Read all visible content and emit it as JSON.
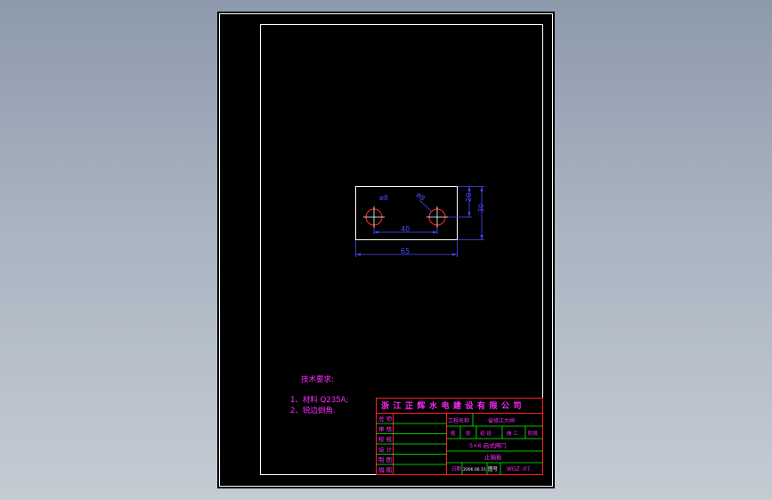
{
  "drawing": {
    "dimensions": {
      "hole_diameter": "ø8",
      "hole_diameter_2": "ø8",
      "height_inner": "20",
      "height_outer": "30",
      "hole_spacing": "40",
      "overall_width": "65"
    },
    "notes": {
      "heading": "技术要求:",
      "line1": "1、材料 Q235A;",
      "line2": "2、锐边倒角."
    },
    "title_block": {
      "company": "浙江正辉水电建设有限公司",
      "row_labels": [
        "总 师",
        "审 核",
        "校 核",
        "设 计",
        "制 图",
        "描 图"
      ],
      "project_label": "工程名称",
      "project_name": "省修江大闸",
      "stage_cells": [
        "规",
        "划",
        "初 设",
        "施 工",
        "阶段"
      ],
      "subject": "5×6 启式闸门",
      "drawing_name": "止轴板",
      "date_label": "日期",
      "date_value": "2006.06.15",
      "number_label": "图号",
      "number_value": "WGZ -07"
    },
    "colors": {
      "background": "#000000",
      "border": "#ffffff",
      "outline": "#ffffff",
      "dimension": "#4a4aff",
      "title_frame": "#ff2020",
      "title_grid": "#00ff00",
      "text": "#ff2aff",
      "hole": "#ff3030"
    }
  }
}
